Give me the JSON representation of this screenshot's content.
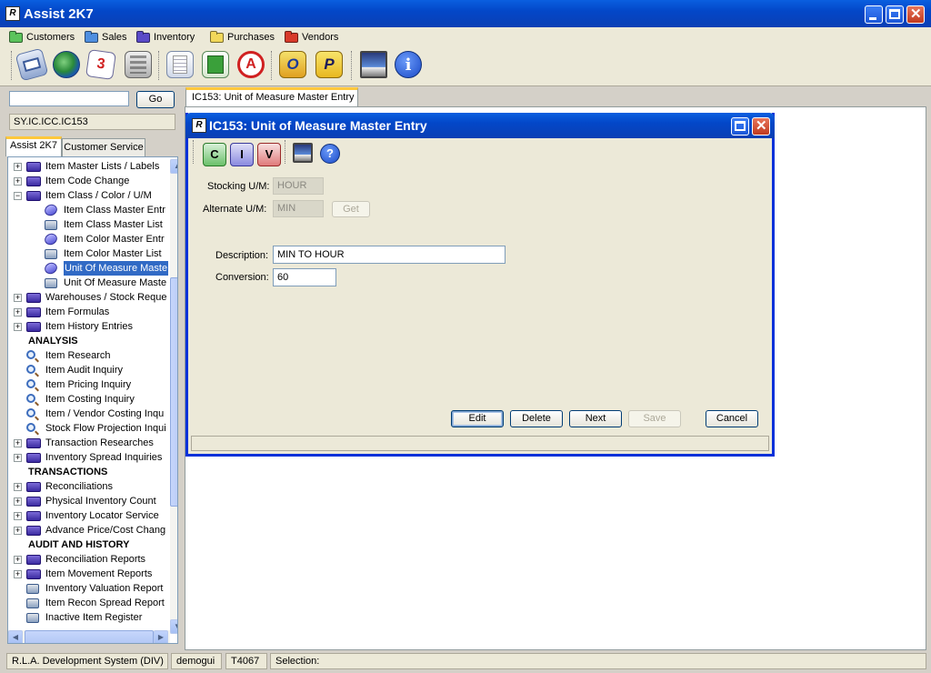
{
  "window": {
    "title": "Assist 2K7",
    "logo": "R"
  },
  "menu": [
    {
      "label": "Customers",
      "color": "#5cc35c"
    },
    {
      "label": "Sales",
      "color": "#4f8fe0"
    },
    {
      "label": "Inventory",
      "color": "#5a4ac8"
    },
    {
      "label": "Purchases",
      "color": "#f2d85a"
    },
    {
      "label": "Vendors",
      "color": "#d83a2a"
    }
  ],
  "toolbar": {
    "icons": [
      "mail-icon",
      "globe-icon",
      "calendar-icon",
      "calculator-icon",
      "report-icon",
      "spreadsheet-icon",
      "pdf-icon",
      "outlook-icon",
      "publisher-icon",
      "screenshot-icon",
      "info-icon"
    ],
    "calendar_day": "3",
    "outlook_letter": "O",
    "publisher_letter": "P",
    "info_letter": "i"
  },
  "left": {
    "search_placeholder": "",
    "go_label": "Go",
    "path": "SY.IC.ICC.IC153",
    "tabs": [
      "Assist 2K7",
      "Customer Service"
    ]
  },
  "tree": [
    {
      "label": "Item Master Lists / Labels",
      "type": "folder",
      "level": 1,
      "exp": "+"
    },
    {
      "label": "Item Code Change",
      "type": "folder",
      "level": 1,
      "exp": "+"
    },
    {
      "label": "Item Class / Color / U/M",
      "type": "folder",
      "level": 1,
      "exp": "-"
    },
    {
      "label": "Item Class Master Entr",
      "type": "doc",
      "level": 2
    },
    {
      "label": "Item Class Master List",
      "type": "print",
      "level": 2
    },
    {
      "label": "Item Color Master Entr",
      "type": "doc",
      "level": 2
    },
    {
      "label": "Item Color Master List",
      "type": "print",
      "level": 2
    },
    {
      "label": "Unit Of Measure Maste",
      "type": "doc",
      "level": 2,
      "selected": true
    },
    {
      "label": "Unit Of Measure Maste",
      "type": "print",
      "level": 2
    },
    {
      "label": "Warehouses / Stock Reque",
      "type": "folder",
      "level": 1,
      "exp": "+"
    },
    {
      "label": "Item Formulas",
      "type": "folder",
      "level": 1,
      "exp": "+"
    },
    {
      "label": "Item History Entries",
      "type": "folder",
      "level": 1,
      "exp": "+"
    },
    {
      "label": "ANALYSIS",
      "type": "heading",
      "level": 1
    },
    {
      "label": "Item Research",
      "type": "search",
      "level": 1
    },
    {
      "label": "Item Audit Inquiry",
      "type": "search",
      "level": 1
    },
    {
      "label": "Item Pricing Inquiry",
      "type": "search",
      "level": 1
    },
    {
      "label": "Item Costing Inquiry",
      "type": "search",
      "level": 1
    },
    {
      "label": "Item / Vendor Costing Inqu",
      "type": "search",
      "level": 1
    },
    {
      "label": "Stock Flow Projection Inqui",
      "type": "search",
      "level": 1
    },
    {
      "label": "Transaction Researches",
      "type": "folder",
      "level": 1,
      "exp": "+"
    },
    {
      "label": "Inventory Spread Inquiries",
      "type": "folder",
      "level": 1,
      "exp": "+"
    },
    {
      "label": "TRANSACTIONS",
      "type": "heading",
      "level": 1
    },
    {
      "label": "Reconciliations",
      "type": "folder",
      "level": 1,
      "exp": "+"
    },
    {
      "label": "Physical Inventory Count",
      "type": "folder",
      "level": 1,
      "exp": "+"
    },
    {
      "label": "Inventory Locator Service",
      "type": "folder",
      "level": 1,
      "exp": "+"
    },
    {
      "label": "Advance Price/Cost Chang",
      "type": "folder",
      "level": 1,
      "exp": "+"
    },
    {
      "label": "AUDIT AND HISTORY",
      "type": "heading",
      "level": 1
    },
    {
      "label": "Reconciliation Reports",
      "type": "folder",
      "level": 1,
      "exp": "+"
    },
    {
      "label": "Item Movement Reports",
      "type": "folder",
      "level": 1,
      "exp": "+"
    },
    {
      "label": "Inventory Valuation Report",
      "type": "print",
      "level": 1
    },
    {
      "label": "Item Recon Spread Report",
      "type": "print",
      "level": 1
    },
    {
      "label": "Inactive Item Register",
      "type": "print",
      "level": 1
    }
  ],
  "doc_tab": {
    "label": "IC153: Unit of Measure Master Entry"
  },
  "dialog": {
    "title": "IC153: Unit of Measure Master Entry",
    "icon_letters": [
      "C",
      "I",
      "V"
    ],
    "help_letter": "?",
    "stocking_label": "Stocking U/M:",
    "stocking_value": "HOUR",
    "alternate_label": "Alternate U/M:",
    "alternate_value": "MIN",
    "get_label": "Get",
    "description_label": "Description:",
    "description_value": "MIN TO HOUR",
    "conversion_label": "Conversion:",
    "conversion_value": "60",
    "buttons": {
      "edit": "Edit",
      "delete": "Delete",
      "next": "Next",
      "save": "Save",
      "cancel": "Cancel"
    }
  },
  "status": {
    "company": "R.L.A. Development System (DIV)",
    "user": "demogui",
    "terminal": "T4067",
    "selection": "Selection:"
  }
}
